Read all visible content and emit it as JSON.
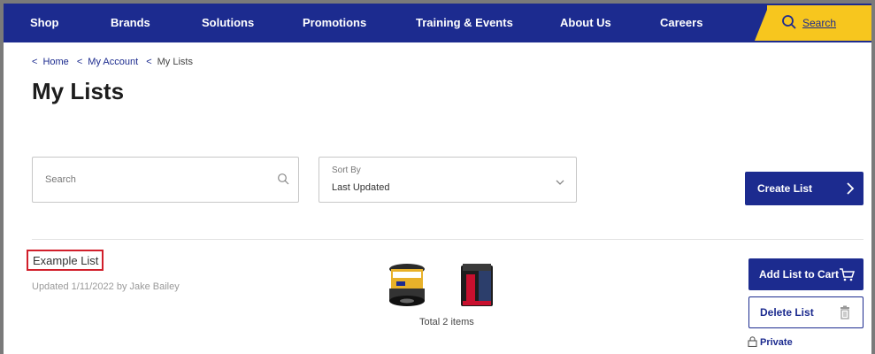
{
  "nav": {
    "items": [
      "Shop",
      "Brands",
      "Solutions",
      "Promotions",
      "Training & Events",
      "About Us",
      "Careers"
    ],
    "search_label": "Search"
  },
  "breadcrumb": {
    "items": [
      "Home",
      "My Account",
      "My Lists"
    ]
  },
  "page_title": "My Lists",
  "search": {
    "placeholder": "Search"
  },
  "sort": {
    "caption": "Sort By",
    "value": "Last Updated"
  },
  "create_label": "Create List",
  "list": {
    "name": "Example List",
    "meta": "Updated 1/11/2022 by Jake Bailey",
    "total": "Total 2 items",
    "add_to_cart_label": "Add List to Cart",
    "delete_label": "Delete List",
    "privacy": "Private"
  },
  "colors": {
    "brand_blue": "#1c2b8f",
    "accent_yellow": "#f7c61e",
    "highlight_red": "#d11f2b"
  },
  "icons": [
    "search-icon",
    "chevron-down-icon",
    "chevron-right-icon",
    "cart-icon",
    "trash-icon",
    "lock-icon"
  ]
}
